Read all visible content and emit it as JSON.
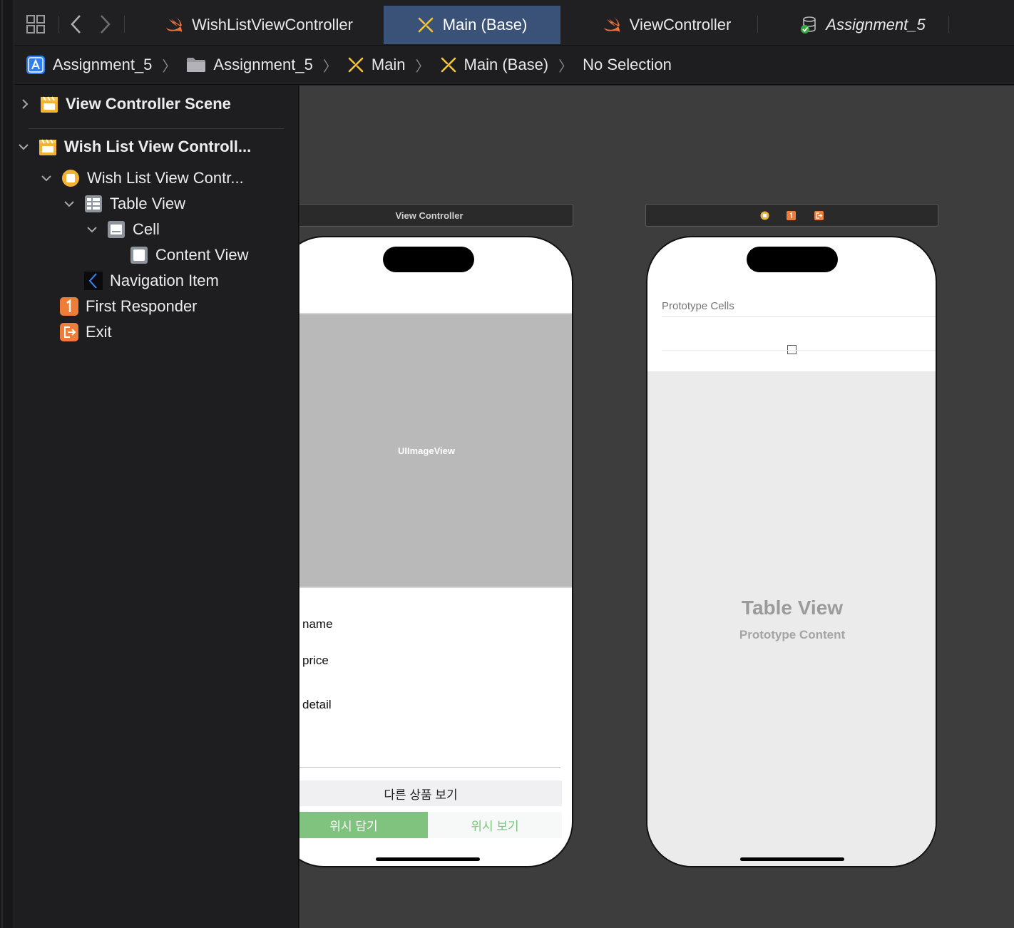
{
  "tabs": [
    {
      "label": "WishListViewController",
      "icon": "swift-icon",
      "active": false
    },
    {
      "label": "Main (Base)",
      "icon": "storyboard-icon",
      "active": true
    },
    {
      "label": "ViewController",
      "icon": "swift-icon",
      "active": false
    },
    {
      "label": "Assignment_5",
      "icon": "database-check-icon",
      "active": false
    }
  ],
  "breadcrumb": [
    {
      "label": "Assignment_5",
      "icon": "xcode-project-icon"
    },
    {
      "label": "Assignment_5",
      "icon": "folder-icon"
    },
    {
      "label": "Main",
      "icon": "storyboard-icon"
    },
    {
      "label": "Main (Base)",
      "icon": "storyboard-icon"
    },
    {
      "label": "No Selection",
      "icon": ""
    }
  ],
  "navigator": {
    "items": [
      {
        "label": "View Controller Scene",
        "icon": "scene-icon",
        "expanded": false
      },
      {
        "label": "Wish List View Controll...",
        "icon": "scene-icon",
        "expanded": true
      },
      {
        "label": "Wish List View Contr...",
        "icon": "view-controller-icon",
        "expanded": true
      },
      {
        "label": "Table View",
        "icon": "table-view-icon",
        "expanded": true
      },
      {
        "label": "Cell",
        "icon": "cell-icon",
        "expanded": true
      },
      {
        "label": "Content View",
        "icon": "content-view-icon"
      },
      {
        "label": "Navigation Item",
        "icon": "navigation-item-icon"
      },
      {
        "label": "First Responder",
        "icon": "first-responder-icon"
      },
      {
        "label": "Exit",
        "icon": "exit-icon"
      }
    ]
  },
  "canvas": {
    "scene1": {
      "title": "View Controller",
      "image_view_label": "UIImageView",
      "name_label": "name",
      "price_label": "price",
      "detail_label": "detail",
      "other_products_button": "다른 상품 보기",
      "add_wish_button": "위시 담기",
      "view_wish_button": "위시 보기"
    },
    "scene2": {
      "prototype_cells_header": "Prototype Cells",
      "table_view_title": "Table View",
      "table_view_subtitle": "Prototype Content"
    }
  },
  "colors": {
    "active_tab": "#3a5278",
    "green_button": "#7fc37f",
    "canvas_bg": "#3d3d3d",
    "swift_orange": "#f0743a",
    "storyboard_yellow": "#f4c534"
  }
}
